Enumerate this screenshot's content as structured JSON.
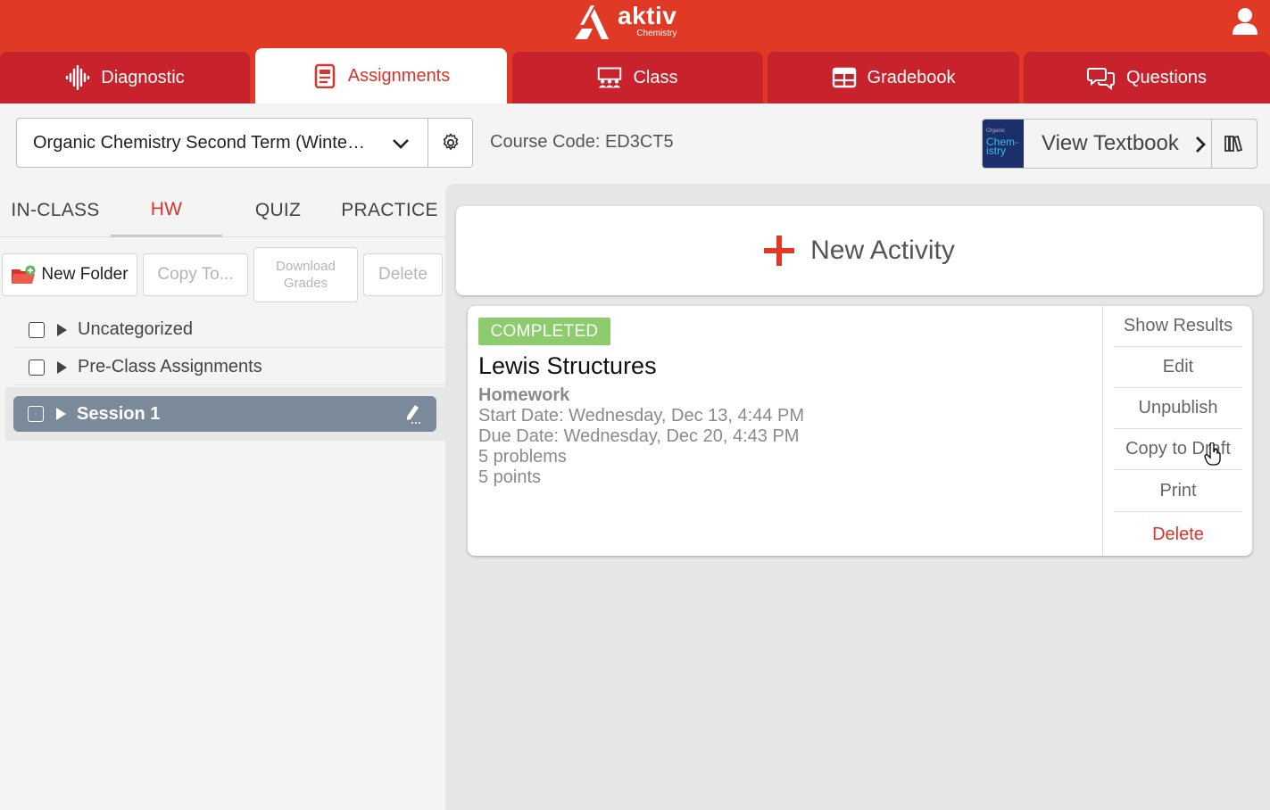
{
  "brand": {
    "name": "aktiv",
    "subtitle": "Chemistry",
    "primary_color": "#e03a26",
    "tab_color": "#c8222c"
  },
  "nav_tabs": [
    {
      "label": "Diagnostic",
      "icon": "waveform-icon",
      "active": false
    },
    {
      "label": "Assignments",
      "icon": "document-icon",
      "active": true
    },
    {
      "label": "Class",
      "icon": "classroom-icon",
      "active": false
    },
    {
      "label": "Gradebook",
      "icon": "table-icon",
      "active": false
    },
    {
      "label": "Questions",
      "icon": "chat-bubbles-icon",
      "active": false
    }
  ],
  "course": {
    "selected": "Organic Chemistry Second Term (Winte…",
    "code_label": "Course Code: ED3CT5"
  },
  "textbook": {
    "label": "View Textbook",
    "thumb_small": "Organic",
    "thumb_title": "Chem-istry"
  },
  "sub_tabs": [
    {
      "label": "IN-CLASS",
      "active": false
    },
    {
      "label": "HW",
      "active": true
    },
    {
      "label": "QUIZ",
      "active": false
    },
    {
      "label": "PRACTICE",
      "active": false
    }
  ],
  "toolbar": {
    "new_folder": "New Folder",
    "copy_to": "Copy To...",
    "download_grades_1": "Download",
    "download_grades_2": "Grades",
    "delete": "Delete"
  },
  "folders": [
    {
      "label": "Uncategorized"
    },
    {
      "label": "Pre-Class Assignments"
    },
    {
      "label": "Session 1",
      "selected": true
    }
  ],
  "new_activity": {
    "label": "New Activity"
  },
  "assignment": {
    "status": "COMPLETED",
    "status_color": "#8ccc6c",
    "title": "Lewis Structures",
    "type": "Homework",
    "start": "Start Date: Wednesday, Dec 13, 4:44 PM",
    "due": "Due Date: Wednesday, Dec 20, 4:43 PM",
    "problems": "5 problems",
    "points": "5 points",
    "actions": [
      "Show Results",
      "Edit",
      "Unpublish",
      "Copy to Draft",
      "Print",
      "Delete"
    ]
  }
}
